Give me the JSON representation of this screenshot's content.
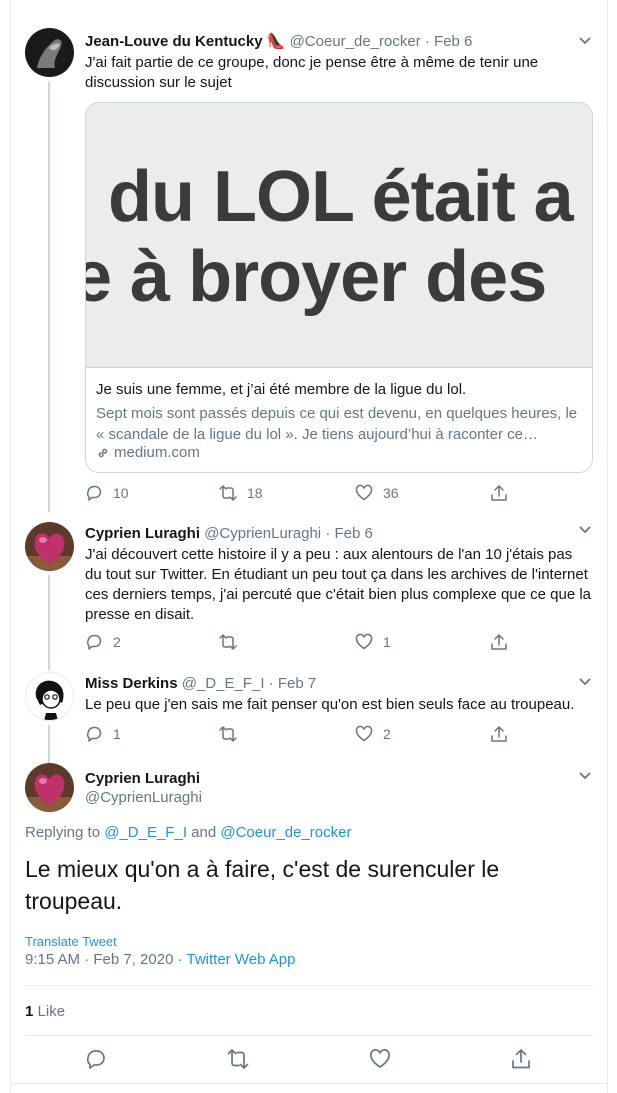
{
  "tweets": [
    {
      "name": "Jean-Louve du Kentucky 👠",
      "handle": "@Coeur_de_rocker",
      "separator": "·",
      "date": "Feb 6",
      "text": "J'ai fait partie de ce groupe, donc je pense être à même de tenir une discussion sur le sujet",
      "card": {
        "image_line1": "du LOL était a",
        "image_line1_prefix": "e",
        "image_line2": "e à broyer des",
        "title": "Je suis une femme, et j’ai été membre de la ligue du lol.",
        "description": "Sept mois sont passés depuis ce qui est devenu, en quelques heures, le « scandale de la ligue du lol ». Je tiens aujourd’hui à raconter ce…",
        "domain": "medium.com"
      },
      "reply_count": "10",
      "retweet_count": "18",
      "like_count": "36"
    },
    {
      "name": "Cyprien Luraghi",
      "handle": "@CyprienLuraghi",
      "separator": "·",
      "date": "Feb 6",
      "text": "J'ai découvert cette histoire il y a peu : aux alentours de l'an 10 j'étais pas du tout sur Twitter. En étudiant un peu tout ça dans les archives de l'internet ces derniers temps, j'ai percuté que c'était bien plus complexe que ce que la presse en disait.",
      "reply_count": "2",
      "retweet_count": "",
      "like_count": "1"
    },
    {
      "name": "Miss Derkins",
      "handle": "@_D_E_F_I",
      "separator": "·",
      "date": "Feb 7",
      "text": "Le  peu que j'en sais me fait penser qu'on est bien seuls face au troupeau.",
      "reply_count": "1",
      "retweet_count": "",
      "like_count": "2"
    }
  ],
  "main": {
    "name": "Cyprien Luraghi",
    "handle": "@CyprienLuraghi",
    "replying_prefix": "Replying to",
    "replying_user1": "@_D_E_F_I",
    "replying_and": "and",
    "replying_user2": "@Coeur_de_rocker",
    "text": "Le mieux qu'on a à faire, c'est de surenculer le troupeau.",
    "translate": "Translate Tweet",
    "timestamp": "9:15 AM · Feb 7, 2020 ·",
    "source": "Twitter Web App",
    "like_count": "1",
    "like_label": "Like"
  },
  "colors": {
    "text": "#14171a",
    "secondary": "#657786",
    "link": "#1b95e0",
    "border": "#e6ecf0"
  },
  "icons": [
    "reply-icon",
    "retweet-icon",
    "like-icon",
    "share-icon",
    "chevron-down-icon",
    "link-icon"
  ]
}
